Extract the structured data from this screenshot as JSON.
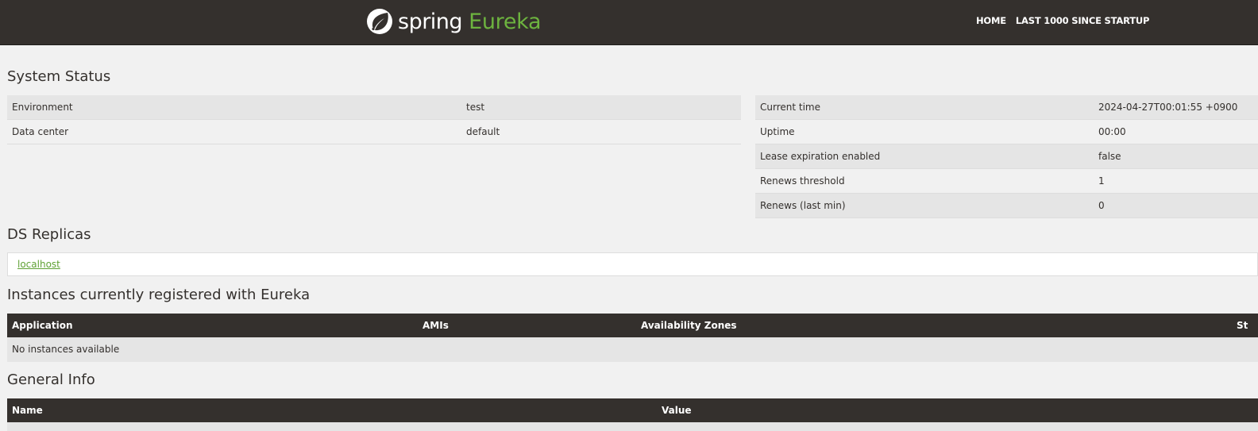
{
  "header": {
    "brand_spring": "spring",
    "brand_eureka": "Eureka",
    "nav": [
      {
        "label": "HOME"
      },
      {
        "label": "LAST 1000 SINCE STARTUP"
      }
    ]
  },
  "system_status": {
    "title": "System Status",
    "environment_rows": [
      {
        "key": "Environment",
        "value": "test"
      },
      {
        "key": "Data center",
        "value": "default"
      }
    ],
    "runtime_rows": [
      {
        "key": "Current time",
        "value": "2024-04-27T00:01:55 +0900"
      },
      {
        "key": "Uptime",
        "value": "00:00"
      },
      {
        "key": "Lease expiration enabled",
        "value": "false"
      },
      {
        "key": "Renews threshold",
        "value": "1"
      },
      {
        "key": "Renews (last min)",
        "value": "0"
      }
    ]
  },
  "ds_replicas": {
    "title": "DS Replicas",
    "items": [
      {
        "label": "localhost"
      }
    ]
  },
  "instances": {
    "title": "Instances currently registered with Eureka",
    "columns": [
      "Application",
      "AMIs",
      "Availability Zones",
      "St"
    ],
    "empty_message": "No instances available"
  },
  "general_info": {
    "title": "General Info",
    "columns": [
      "Name",
      "Value"
    ]
  },
  "colors": {
    "navbar": "#34302d",
    "accent_green": "#6db33f",
    "background": "#f1f1f1",
    "row_stripe": "#e5e5e5"
  },
  "icons": {
    "brand": "spring-leaf-icon"
  }
}
